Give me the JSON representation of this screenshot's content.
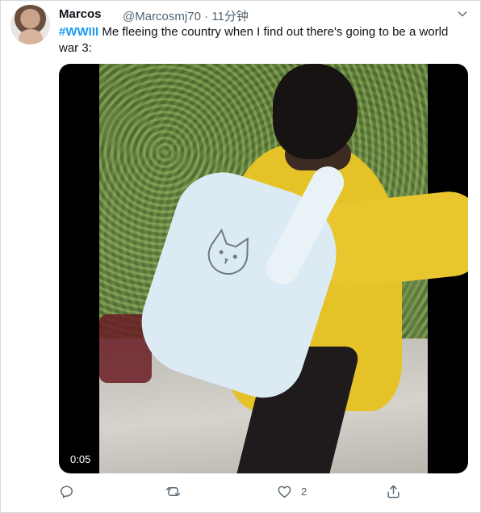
{
  "tweet": {
    "author_name": "Marcos",
    "author_handle": "@Marcosmj70",
    "separator": "·",
    "time_ago": "11分钟",
    "hashtag": "#WWIII",
    "text": " Me fleeing the country when I find out there's going to be a world war 3:"
  },
  "media": {
    "duration": "0:05"
  },
  "actions": {
    "reply_icon": "reply-icon",
    "retweet_icon": "retweet-icon",
    "like_icon": "like-icon",
    "like_count": "2",
    "share_icon": "share-icon"
  },
  "colors": {
    "link": "#1d9bf0",
    "secondary_text": "#536471",
    "border": "#cfd9de"
  }
}
